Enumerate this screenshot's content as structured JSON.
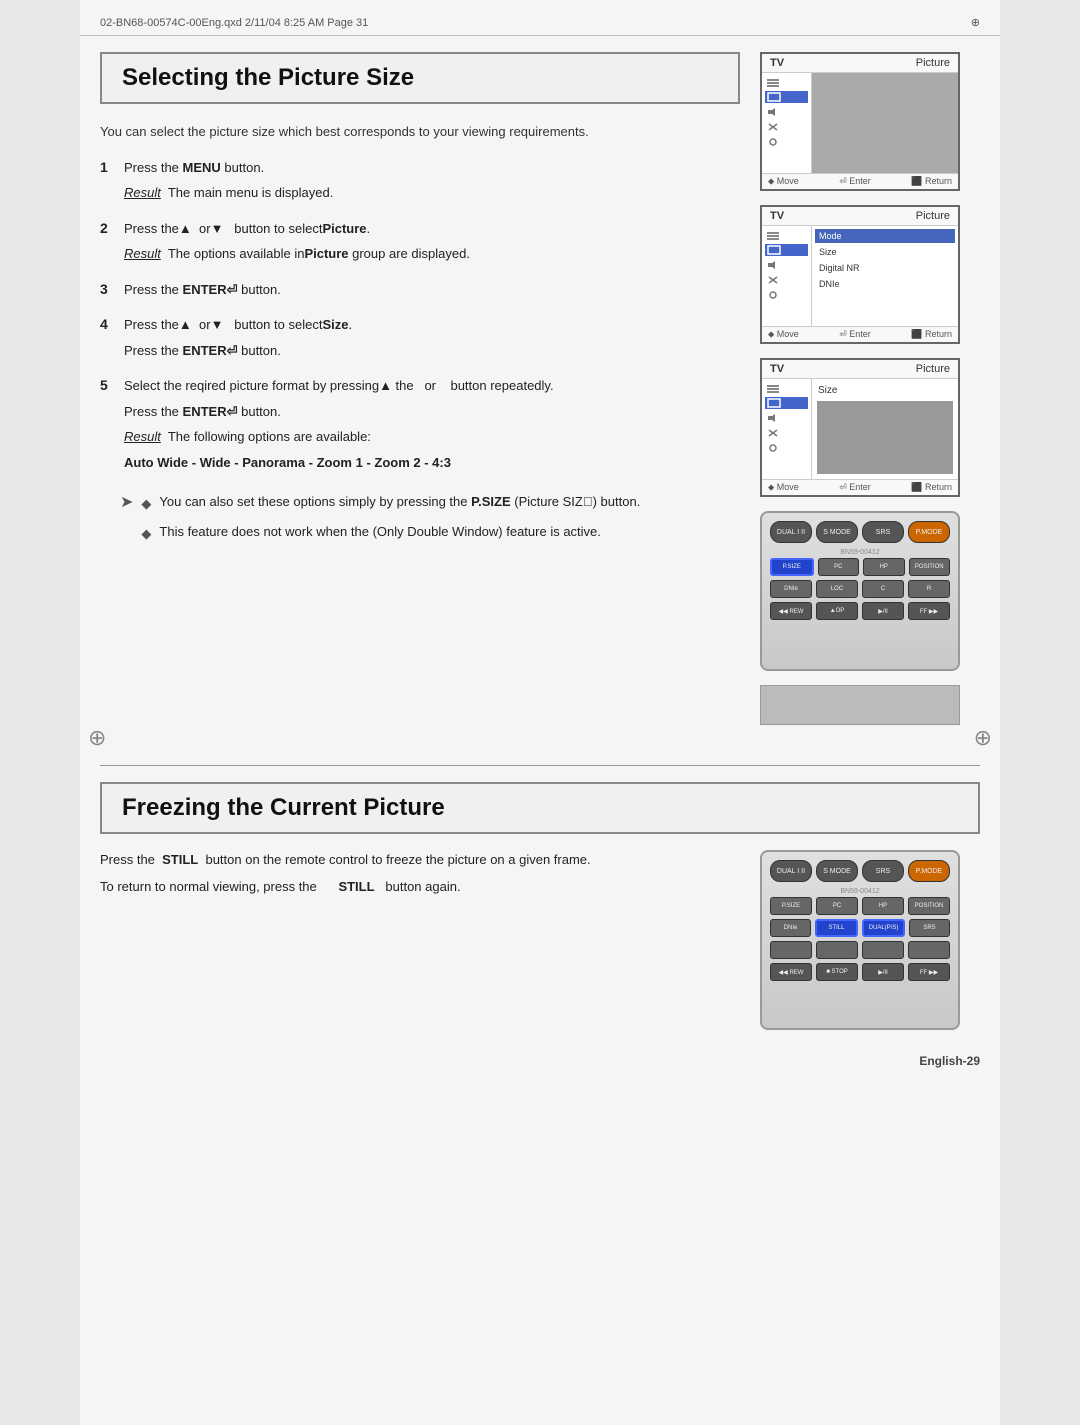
{
  "page": {
    "file_path": "02-BN68-00574C-00Eng.qxd  2/11/04  8:25 AM  Page 31",
    "footer": "English-29"
  },
  "section1": {
    "heading": "Selecting the Picture Size",
    "intro": "You can select the picture size which best corresponds to your viewing requirements.",
    "steps": [
      {
        "number": "1",
        "text": "Press the MENU button.",
        "result": "The main menu is displayed."
      },
      {
        "number": "2",
        "text": "Press the ▲ or ▼ button to select Picture.",
        "result": "The options available in Picture group are displayed."
      },
      {
        "number": "3",
        "text": "Press the ENTER button."
      },
      {
        "number": "4",
        "text": "Press the ▲ or ▼ button to select Size.",
        "text2": "Press the ENTER button."
      },
      {
        "number": "5",
        "text": "Select the reqired picture format by pressing the ▲ or button repeatedly.",
        "text2": "Press the ENTER button.",
        "result": "The following options are available:",
        "options": "Auto Wide - Wide - Panorama - Zoom 1 - Zoom 2 - 4:3"
      }
    ],
    "notes": [
      "You can also set these options simply by pressing the P.SIZE (Picture SIZE) button.",
      "This feature does not work when the (Only Double Window) feature is active."
    ]
  },
  "section2": {
    "heading": "Freezing the Current Picture",
    "para1": "Press the  STILL  button on the remote control to freeze the picture on a given frame.",
    "para2": "To return to normal viewing, press the       STILL  button again."
  },
  "tv_screens": [
    {
      "label": "TV",
      "label_right": "Picture",
      "menu_items": [
        "■",
        "◆",
        "◀",
        "✕",
        "≡"
      ],
      "footer": [
        "Move",
        "Enter",
        "Return"
      ]
    },
    {
      "label": "TV",
      "label_right": "Picture",
      "menu_items": [
        "■",
        "◆",
        "◀",
        "✕",
        "≡"
      ],
      "footer": [
        "Move",
        "Enter",
        "Return"
      ]
    },
    {
      "label": "TV",
      "label_right": "Picture",
      "menu_items": [
        "■",
        "◆",
        "◀",
        "✕",
        "≡"
      ],
      "size_label": "Size",
      "footer": [
        "Move",
        "Enter",
        "Return"
      ]
    }
  ],
  "remote": {
    "top_buttons": [
      "DUAL I II",
      "S MODE",
      "SRS",
      "P.MODE"
    ],
    "model": "BN59-00412",
    "mid_buttons": [
      "P.SIZE",
      "PC",
      "HP",
      "POSITION(S)"
    ],
    "nav_buttons": [
      "DNIe",
      "STILL",
      "DUAL(P/S)",
      "SRS"
    ],
    "bottom_buttons": [
      "REW",
      "STOP",
      "PLAY/PAUSE",
      "FF"
    ]
  }
}
